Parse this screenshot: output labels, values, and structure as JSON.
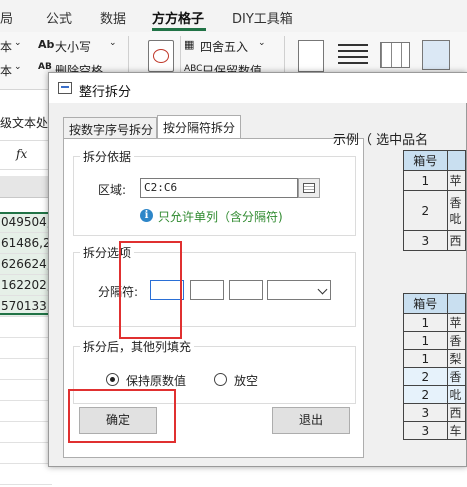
{
  "ribbon": {
    "tabs": [
      "局",
      "公式",
      "数据",
      "方方格子",
      "DIY工具箱"
    ],
    "active_tab": "方方格子",
    "row1": {
      "left_frag": "本",
      "size_case": "大小写",
      "round": "四舍五入"
    },
    "row2": {
      "left_frag": "本",
      "delete_space": "删除空格",
      "keep_value": "只保留数值"
    },
    "left_side_label": "级文本处"
  },
  "sheet": {
    "fx": "fx",
    "cells": [
      "049504,",
      "61486,2",
      "626624,",
      "162202,",
      "570133,"
    ]
  },
  "dialog": {
    "title": "整行拆分",
    "tabs": [
      "按数字序号拆分",
      "按分隔符拆分"
    ],
    "active_tab": "按分隔符拆分",
    "split_basis": {
      "title": "拆分依据",
      "range_label": "区域:",
      "range_value": "C2:C6",
      "info": "只允许单列（含分隔符)"
    },
    "split_options": {
      "title": "拆分选项",
      "sep_label": "分隔符:"
    },
    "after_split": {
      "title": "拆分后，其他列填充",
      "keep_original": "保持原数值",
      "leave_empty": "放空"
    },
    "ok": "确定",
    "exit": "退出",
    "example": {
      "label": "示例（ 选中品名",
      "table1": {
        "header": "箱号",
        "rows": [
          "1",
          "2",
          "3"
        ],
        "partial": [
          "苹",
          "香\n吡",
          "西"
        ]
      },
      "table2": {
        "header": "箱号",
        "rows": [
          "1",
          "1",
          "1",
          "2",
          "2",
          "3",
          "3"
        ],
        "partial": [
          "苹",
          "香",
          "梨",
          "香",
          "吡",
          "西",
          "车"
        ]
      }
    }
  },
  "colors": {
    "accent": "#217346",
    "highlight": "#e03030",
    "link_info": "#2f8a2f",
    "table_header": "#c9dff0"
  }
}
